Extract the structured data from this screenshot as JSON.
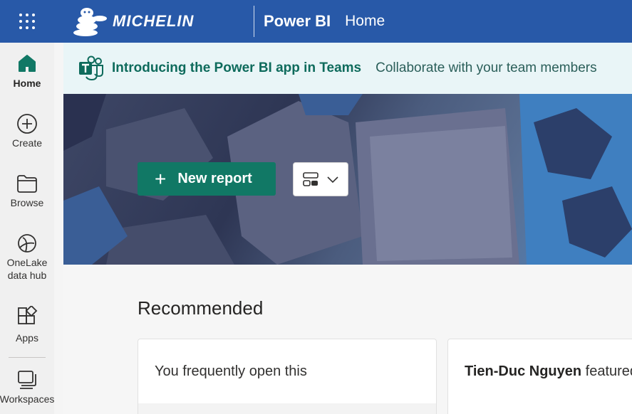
{
  "topbar": {
    "brand": "MICHELIN",
    "app_name": "Power BI",
    "breadcrumb": "Home"
  },
  "nav": {
    "items": [
      {
        "label": "Home",
        "icon": "home-icon"
      },
      {
        "label": "Create",
        "icon": "plus-circle-icon"
      },
      {
        "label": "Browse",
        "icon": "folder-icon"
      },
      {
        "label": "OneLake\ndata hub",
        "icon": "onelake-icon"
      },
      {
        "label": "Apps",
        "icon": "apps-icon"
      },
      {
        "label": "Workspaces",
        "icon": "workspaces-icon"
      }
    ]
  },
  "banner": {
    "title": "Introducing the Power BI app in Teams",
    "description": "Collaborate with your team members"
  },
  "hero": {
    "new_report_label": "New report"
  },
  "recommended": {
    "title": "Recommended",
    "cards": [
      {
        "text": "You frequently open this"
      },
      {
        "author": "Tien-Duc Nguyen",
        "suffix": " featured"
      }
    ]
  },
  "colors": {
    "topbar": "#2859a8",
    "accent_green": "#117865",
    "banner_bg": "#e9f5f7"
  }
}
